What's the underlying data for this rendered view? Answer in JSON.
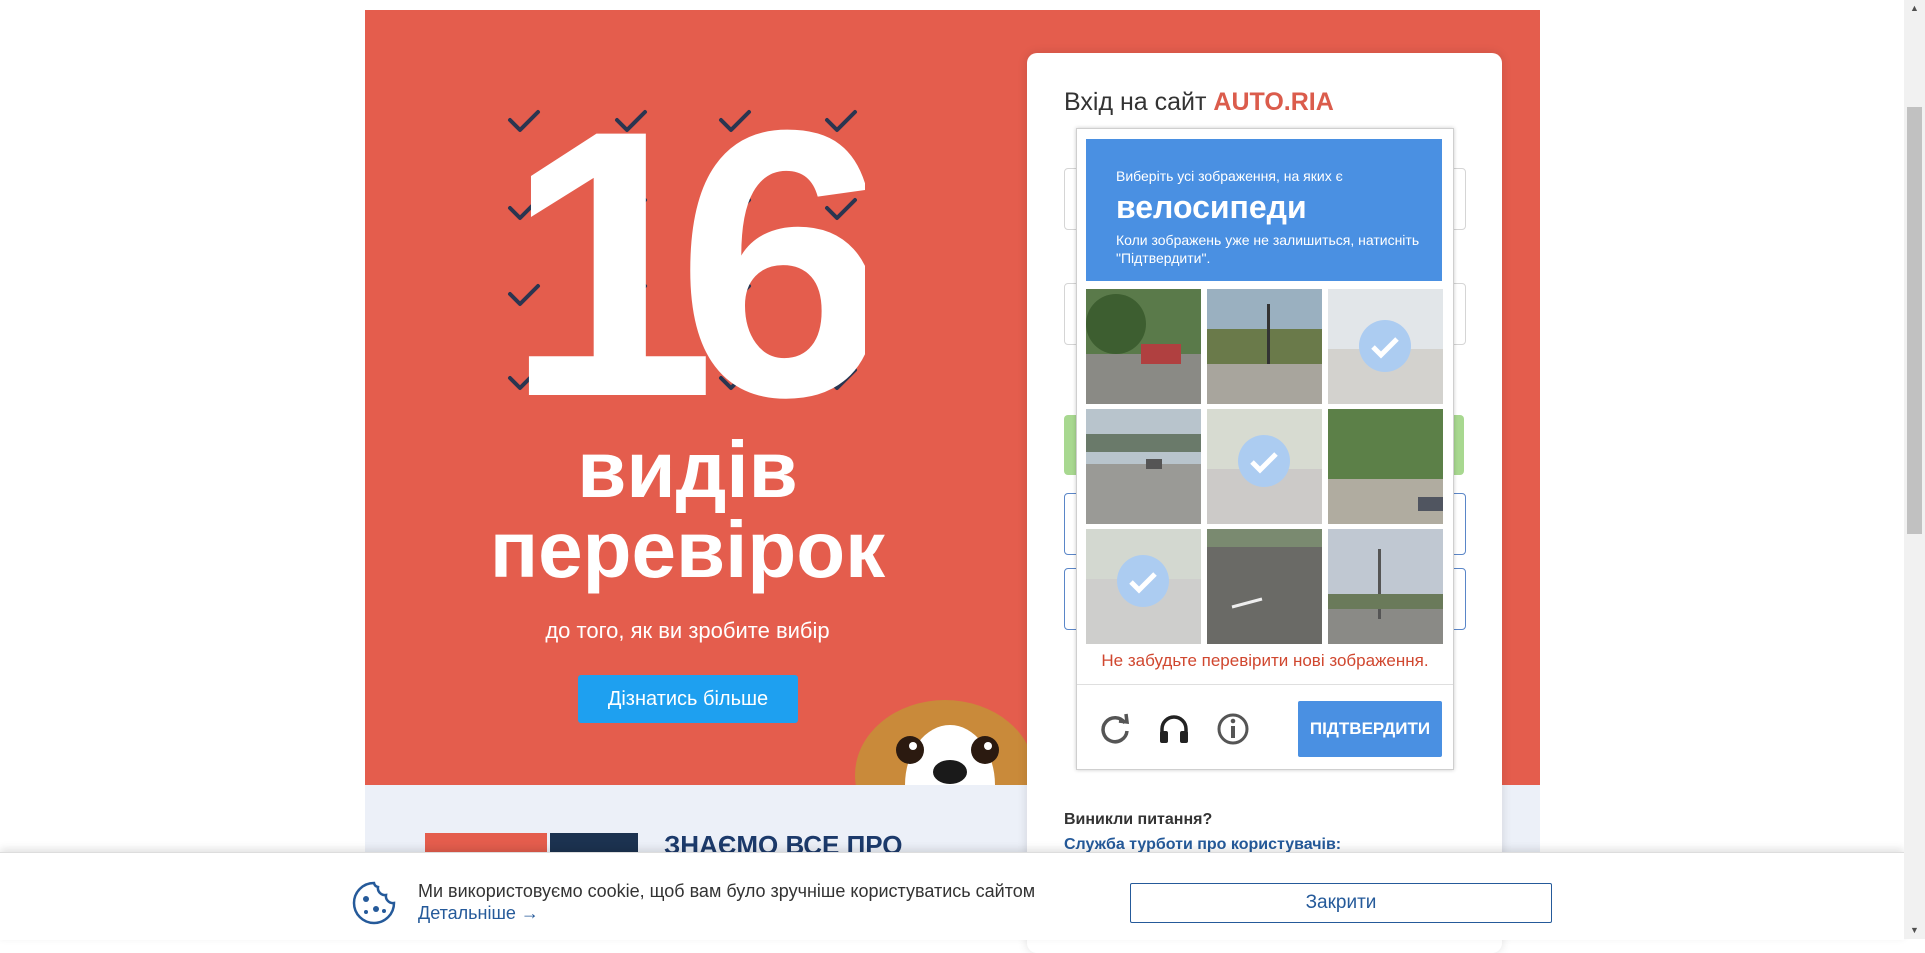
{
  "promo": {
    "number": "16",
    "line1": "видів",
    "line2": "перевірок",
    "subtitle": "до того, як ви зробите вибір",
    "button": "Дізнатись більше"
  },
  "lower": {
    "title": "ЗНАЄМО ВСЕ ПРО"
  },
  "login": {
    "title_prefix": "Вхід на сайт",
    "brand": "AUTO.RIA",
    "questions": "Виникли питання?",
    "support_link": "Служба турботи про користувачів:"
  },
  "captcha": {
    "instruction_line1": "Виберіть усі зображення, на яких є",
    "target": "велосипеди",
    "instruction_line3": "Коли зображень уже не залишиться, натисніть \"Підтвердити\".",
    "tiles": [
      {
        "selected": false
      },
      {
        "selected": false
      },
      {
        "selected": true
      },
      {
        "selected": false
      },
      {
        "selected": true
      },
      {
        "selected": false
      },
      {
        "selected": true
      },
      {
        "selected": false
      },
      {
        "selected": false
      }
    ],
    "warning": "Не забудьте перевірити нові зображення.",
    "verify_button": "ПІДТВЕРДИТИ",
    "icons": [
      "reload-icon",
      "headphones-icon",
      "info-icon"
    ]
  },
  "cookie": {
    "text": "Ми використовуємо cookie, щоб вам було зручніше користуватись сайтом",
    "more_link": "Детальніше →",
    "close_button": "Закрити"
  },
  "colors": {
    "promo_bg": "#e45d4d",
    "captcha_blue": "#4a90e2",
    "brand_red": "#db5c4c",
    "link_blue": "#255a9a"
  }
}
